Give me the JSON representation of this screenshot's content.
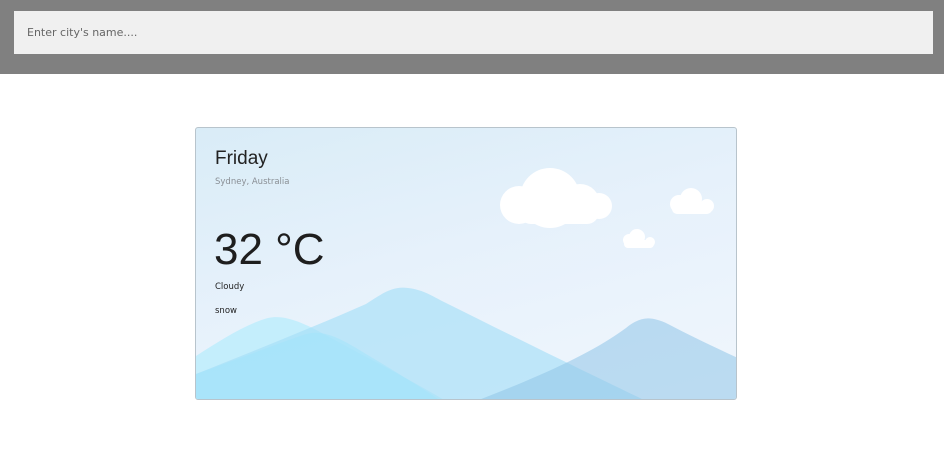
{
  "search": {
    "placeholder": "Enter city's name...."
  },
  "weather": {
    "day": "Friday",
    "location": "Sydney, Australia",
    "temperature": "32 °C",
    "condition": "Cloudy",
    "description": "snow"
  },
  "colors": {
    "topbar": "#808080",
    "search_bg": "#f0f0f0",
    "card_border": "#b8c4cc",
    "cloud": "#ffffff",
    "mountain_light": "#a8e4fb",
    "mountain_mid": "#9ad8f5",
    "mountain_right": "#9dcaea"
  },
  "icons": [
    "cloud-icon",
    "mountain-illustration"
  ]
}
